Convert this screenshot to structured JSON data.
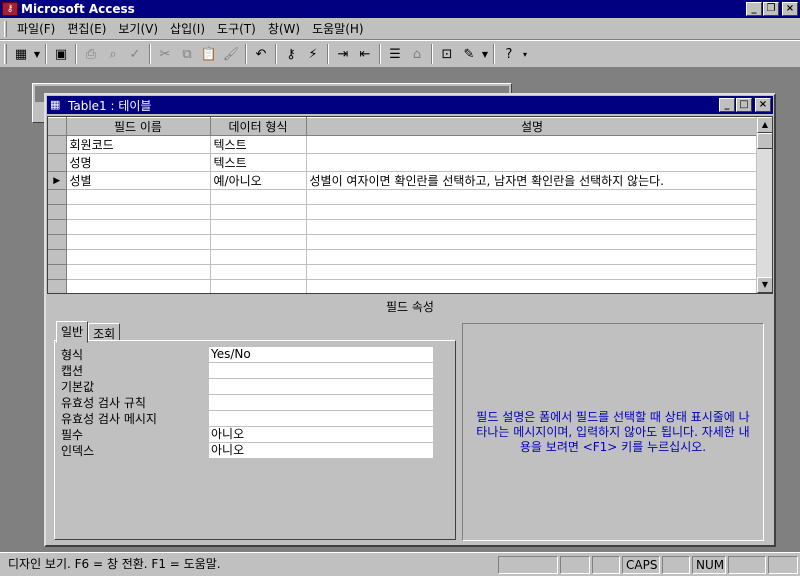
{
  "window": {
    "title": "Microsoft Access",
    "icon": "access-key-icon"
  },
  "menu": [
    "파일(F)",
    "편집(E)",
    "보기(V)",
    "삽입(I)",
    "도구(T)",
    "창(W)",
    "도움말(H)"
  ],
  "design_window": {
    "title": "Table1 : 테이블"
  },
  "grid": {
    "headers": [
      "필드 이름",
      "데이터 형식",
      "설명"
    ],
    "rows": [
      {
        "name": "회원코드",
        "type": "텍스트",
        "desc": ""
      },
      {
        "name": "성명",
        "type": "텍스트",
        "desc": ""
      },
      {
        "name": "성별",
        "type": "예/아니오",
        "desc": "성별이 여자이면 확인란를 선택하고, 남자면 확인란을 선택하지 않는다."
      }
    ]
  },
  "field_props": {
    "header": "필드 속성",
    "tabs": [
      "일반",
      "조회"
    ],
    "rows": [
      {
        "label": "형식",
        "value": "Yes/No"
      },
      {
        "label": "캡션",
        "value": ""
      },
      {
        "label": "기본값",
        "value": ""
      },
      {
        "label": "유효성 검사 규칙",
        "value": ""
      },
      {
        "label": "유효성 검사 메시지",
        "value": ""
      },
      {
        "label": "필수",
        "value": "아니오"
      },
      {
        "label": "인덱스",
        "value": "아니오"
      }
    ],
    "help": "필드 설명은 폼에서 필드를 선택할 때 상태 표시줄에 나타나는 메시지이며, 입력하지 않아도 됩니다. 자세한 내용을 보려면 <F1> 키를 누르십시오."
  },
  "status": {
    "message": "디자인 보기.  F6 = 창 전환.  F1 = 도움말.",
    "caps": "CAPS",
    "num": "NUM"
  },
  "colors": {
    "titlebar": "#000080",
    "face": "#c0c0c0",
    "help_text": "#0000c0"
  }
}
